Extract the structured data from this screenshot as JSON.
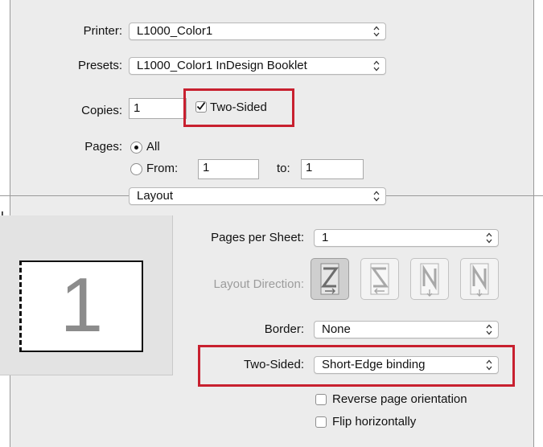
{
  "print_dialog": {
    "printer": {
      "label": "Printer:",
      "value": "L1000_Color1"
    },
    "presets": {
      "label": "Presets:",
      "value": "L1000_Color1 InDesign Booklet"
    },
    "copies": {
      "label": "Copies:",
      "value": "1",
      "two_sided_label": "Two-Sided",
      "two_sided_checked": true
    },
    "pages": {
      "label": "Pages:",
      "all_label": "All",
      "from_label": "From:",
      "from_value": "1",
      "to_label": "to:",
      "to_value": "1"
    },
    "section_select": {
      "value": "Layout"
    },
    "edge_char": "l"
  },
  "preview": {
    "page_number": "1"
  },
  "layout": {
    "pages_per_sheet": {
      "label": "Pages per Sheet:",
      "value": "1"
    },
    "layout_direction": {
      "label": "Layout Direction:",
      "options": [
        "Z",
        "S",
        "N-reverse",
        "N"
      ]
    },
    "border": {
      "label": "Border:",
      "value": "None"
    },
    "two_sided": {
      "label": "Two-Sided:",
      "value": "Short-Edge binding"
    },
    "reverse_orientation": {
      "label": "Reverse page orientation",
      "checked": false
    },
    "flip_horizontally": {
      "label": "Flip horizontally",
      "checked": false
    }
  },
  "colors": {
    "highlight": "#c8202f",
    "panel": "#ececec"
  }
}
